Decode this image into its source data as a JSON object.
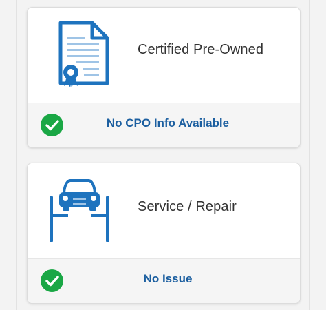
{
  "colors": {
    "accent_blue": "#1e73be",
    "status_text": "#1c5fa0",
    "check_green": "#1aa745"
  },
  "cards": [
    {
      "title": "Certified Pre-Owned",
      "icon": "certificate-icon",
      "status_icon": "check-circle-icon",
      "status": "No CPO Info Available"
    },
    {
      "title": "Service / Repair",
      "icon": "car-lift-icon",
      "status_icon": "check-circle-icon",
      "status": "No Issue"
    }
  ]
}
